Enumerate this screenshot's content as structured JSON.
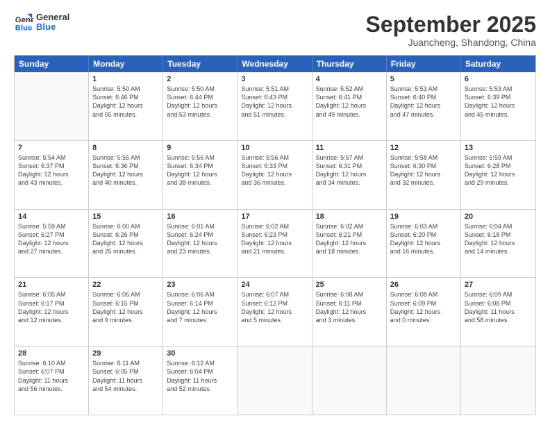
{
  "logo": {
    "line1": "General",
    "line2": "Blue"
  },
  "title": "September 2025",
  "subtitle": "Juancheng, Shandong, China",
  "weekdays": [
    "Sunday",
    "Monday",
    "Tuesday",
    "Wednesday",
    "Thursday",
    "Friday",
    "Saturday"
  ],
  "rows": [
    [
      {
        "day": "",
        "lines": []
      },
      {
        "day": "1",
        "lines": [
          "Sunrise: 5:50 AM",
          "Sunset: 6:46 PM",
          "Daylight: 12 hours",
          "and 55 minutes."
        ]
      },
      {
        "day": "2",
        "lines": [
          "Sunrise: 5:50 AM",
          "Sunset: 6:44 PM",
          "Daylight: 12 hours",
          "and 53 minutes."
        ]
      },
      {
        "day": "3",
        "lines": [
          "Sunrise: 5:51 AM",
          "Sunset: 6:43 PM",
          "Daylight: 12 hours",
          "and 51 minutes."
        ]
      },
      {
        "day": "4",
        "lines": [
          "Sunrise: 5:52 AM",
          "Sunset: 6:41 PM",
          "Daylight: 12 hours",
          "and 49 minutes."
        ]
      },
      {
        "day": "5",
        "lines": [
          "Sunrise: 5:53 AM",
          "Sunset: 6:40 PM",
          "Daylight: 12 hours",
          "and 47 minutes."
        ]
      },
      {
        "day": "6",
        "lines": [
          "Sunrise: 5:53 AM",
          "Sunset: 6:39 PM",
          "Daylight: 12 hours",
          "and 45 minutes."
        ]
      }
    ],
    [
      {
        "day": "7",
        "lines": [
          "Sunrise: 5:54 AM",
          "Sunset: 6:37 PM",
          "Daylight: 12 hours",
          "and 43 minutes."
        ]
      },
      {
        "day": "8",
        "lines": [
          "Sunrise: 5:55 AM",
          "Sunset: 6:36 PM",
          "Daylight: 12 hours",
          "and 40 minutes."
        ]
      },
      {
        "day": "9",
        "lines": [
          "Sunrise: 5:56 AM",
          "Sunset: 6:34 PM",
          "Daylight: 12 hours",
          "and 38 minutes."
        ]
      },
      {
        "day": "10",
        "lines": [
          "Sunrise: 5:56 AM",
          "Sunset: 6:33 PM",
          "Daylight: 12 hours",
          "and 36 minutes."
        ]
      },
      {
        "day": "11",
        "lines": [
          "Sunrise: 5:57 AM",
          "Sunset: 6:31 PM",
          "Daylight: 12 hours",
          "and 34 minutes."
        ]
      },
      {
        "day": "12",
        "lines": [
          "Sunrise: 5:58 AM",
          "Sunset: 6:30 PM",
          "Daylight: 12 hours",
          "and 32 minutes."
        ]
      },
      {
        "day": "13",
        "lines": [
          "Sunrise: 5:59 AM",
          "Sunset: 6:28 PM",
          "Daylight: 12 hours",
          "and 29 minutes."
        ]
      }
    ],
    [
      {
        "day": "14",
        "lines": [
          "Sunrise: 5:59 AM",
          "Sunset: 6:27 PM",
          "Daylight: 12 hours",
          "and 27 minutes."
        ]
      },
      {
        "day": "15",
        "lines": [
          "Sunrise: 6:00 AM",
          "Sunset: 6:26 PM",
          "Daylight: 12 hours",
          "and 25 minutes."
        ]
      },
      {
        "day": "16",
        "lines": [
          "Sunrise: 6:01 AM",
          "Sunset: 6:24 PM",
          "Daylight: 12 hours",
          "and 23 minutes."
        ]
      },
      {
        "day": "17",
        "lines": [
          "Sunrise: 6:02 AM",
          "Sunset: 6:23 PM",
          "Daylight: 12 hours",
          "and 21 minutes."
        ]
      },
      {
        "day": "18",
        "lines": [
          "Sunrise: 6:02 AM",
          "Sunset: 6:21 PM",
          "Daylight: 12 hours",
          "and 18 minutes."
        ]
      },
      {
        "day": "19",
        "lines": [
          "Sunrise: 6:03 AM",
          "Sunset: 6:20 PM",
          "Daylight: 12 hours",
          "and 16 minutes."
        ]
      },
      {
        "day": "20",
        "lines": [
          "Sunrise: 6:04 AM",
          "Sunset: 6:18 PM",
          "Daylight: 12 hours",
          "and 14 minutes."
        ]
      }
    ],
    [
      {
        "day": "21",
        "lines": [
          "Sunrise: 6:05 AM",
          "Sunset: 6:17 PM",
          "Daylight: 12 hours",
          "and 12 minutes."
        ]
      },
      {
        "day": "22",
        "lines": [
          "Sunrise: 6:05 AM",
          "Sunset: 6:15 PM",
          "Daylight: 12 hours",
          "and 9 minutes."
        ]
      },
      {
        "day": "23",
        "lines": [
          "Sunrise: 6:06 AM",
          "Sunset: 6:14 PM",
          "Daylight: 12 hours",
          "and 7 minutes."
        ]
      },
      {
        "day": "24",
        "lines": [
          "Sunrise: 6:07 AM",
          "Sunset: 6:12 PM",
          "Daylight: 12 hours",
          "and 5 minutes."
        ]
      },
      {
        "day": "25",
        "lines": [
          "Sunrise: 6:08 AM",
          "Sunset: 6:11 PM",
          "Daylight: 12 hours",
          "and 3 minutes."
        ]
      },
      {
        "day": "26",
        "lines": [
          "Sunrise: 6:08 AM",
          "Sunset: 6:09 PM",
          "Daylight: 12 hours",
          "and 0 minutes."
        ]
      },
      {
        "day": "27",
        "lines": [
          "Sunrise: 6:09 AM",
          "Sunset: 6:08 PM",
          "Daylight: 11 hours",
          "and 58 minutes."
        ]
      }
    ],
    [
      {
        "day": "28",
        "lines": [
          "Sunrise: 6:10 AM",
          "Sunset: 6:07 PM",
          "Daylight: 11 hours",
          "and 56 minutes."
        ]
      },
      {
        "day": "29",
        "lines": [
          "Sunrise: 6:11 AM",
          "Sunset: 6:05 PM",
          "Daylight: 11 hours",
          "and 54 minutes."
        ]
      },
      {
        "day": "30",
        "lines": [
          "Sunrise: 6:12 AM",
          "Sunset: 6:04 PM",
          "Daylight: 11 hours",
          "and 52 minutes."
        ]
      },
      {
        "day": "",
        "lines": []
      },
      {
        "day": "",
        "lines": []
      },
      {
        "day": "",
        "lines": []
      },
      {
        "day": "",
        "lines": []
      }
    ]
  ]
}
